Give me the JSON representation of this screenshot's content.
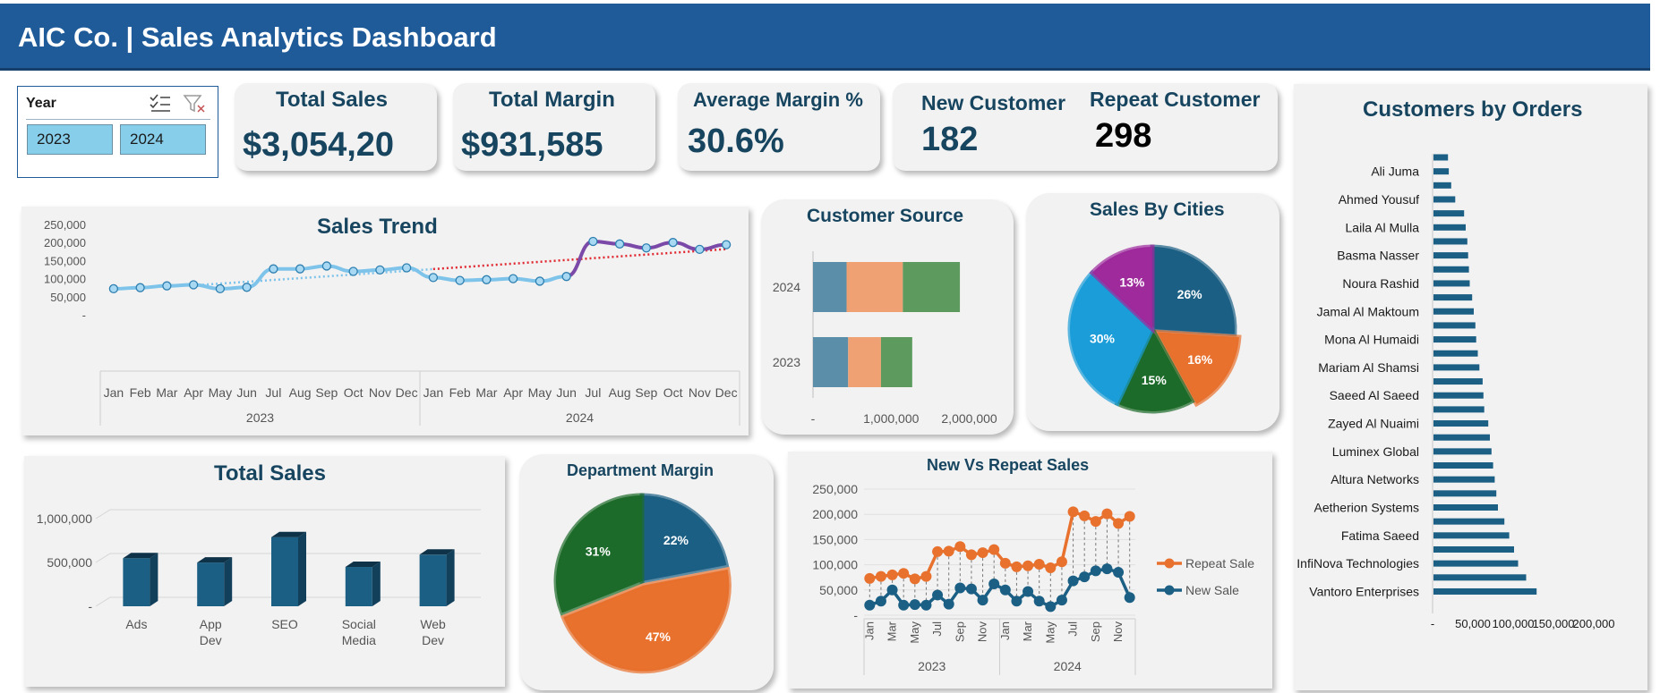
{
  "header": {
    "title": "AIC Co. | Sales Analytics Dashboard"
  },
  "slicer": {
    "title": "Year",
    "options": [
      "2023",
      "2024"
    ]
  },
  "kpis": {
    "total_sales": {
      "label": "Total Sales",
      "value": "$3,054,20"
    },
    "total_margin": {
      "label": "Total Margin",
      "value": "$931,585"
    },
    "average_margin": {
      "label": "Average Margin %",
      "value": "30.6%"
    },
    "new_customer": {
      "label": "New Customer",
      "value": "182"
    },
    "repeat_customer": {
      "label": "Repeat Customer",
      "value": "298"
    }
  },
  "colors": {
    "header": "#1f5b99",
    "text": "#17455f",
    "trend_2023": "#7ec3ea",
    "trend_2024": "#7b4aa8",
    "trendline": "#e0262e",
    "bar": "#1b5f84",
    "orange": "#e8712e",
    "green": "#1d6b2a",
    "light_blue": "#1b9dd9",
    "purple": "#9e2a9c",
    "src_1": "#5b8ea8",
    "src_2": "#f0a173",
    "src_3": "#5c9a5e"
  },
  "chart_data": [
    {
      "id": "sales-trend",
      "type": "line",
      "title": "Sales Trend",
      "categories": [
        "Jan",
        "Feb",
        "Mar",
        "Apr",
        "May",
        "Jun",
        "Jul",
        "Aug",
        "Sep",
        "Oct",
        "Nov",
        "Dec",
        "Jan",
        "Feb",
        "Mar",
        "Apr",
        "May",
        "Jun",
        "Jul",
        "Aug",
        "Sep",
        "Oct",
        "Nov",
        "Dec"
      ],
      "groups": [
        "2023",
        "2024"
      ],
      "values": [
        72000,
        75000,
        80000,
        83000,
        72000,
        76000,
        127000,
        127000,
        135000,
        120000,
        124000,
        130000,
        103000,
        95000,
        97000,
        100000,
        93000,
        106000,
        203000,
        196000,
        185000,
        200000,
        181000,
        194000
      ],
      "yticks": [
        "-",
        "50,000",
        "100,000",
        "150,000",
        "200,000",
        "250,000"
      ],
      "ylim": [
        0,
        250000
      ],
      "trendline": true
    },
    {
      "id": "customer-source",
      "type": "bar",
      "title": "Customer Source",
      "categories": [
        "2024",
        "2023"
      ],
      "series": [
        {
          "values": [
            430000,
            450000
          ]
        },
        {
          "values": [
            720000,
            420000
          ]
        },
        {
          "values": [
            730000,
            400000
          ]
        }
      ],
      "xticks": [
        "-",
        "1,000,000",
        "2,000,000"
      ],
      "xlim": [
        0,
        2200000
      ]
    },
    {
      "id": "sales-by-cities",
      "type": "pie",
      "title": "Sales By Cities",
      "slices": [
        {
          "value": 26,
          "label": "26%"
        },
        {
          "value": 16,
          "label": "16%"
        },
        {
          "value": 15,
          "label": "15%"
        },
        {
          "value": 30,
          "label": "30%"
        },
        {
          "value": 13,
          "label": "13%"
        }
      ]
    },
    {
      "id": "customers-by-orders",
      "type": "bar",
      "title": "Customers by Orders",
      "categories": [
        "",
        "Ali Juma",
        "",
        "Ahmed Yousuf",
        "",
        "Laila Al Mulla",
        "",
        "Basma Nasser",
        "",
        "Noura Rashid",
        "",
        "Jamal Al Maktoum",
        "",
        "Mona Al Humaidi",
        "",
        "Mariam Al Shamsi",
        "",
        "Saeed Al Saeed",
        "",
        "Zayed Al Nuaimi",
        "",
        "Luminex Global",
        "",
        "Altura Networks",
        "",
        "Aetherion Systems",
        "",
        "Fatima Saeed",
        "",
        "InfiNova Technologies",
        "",
        "Vantoro Enterprises"
      ],
      "values": [
        18000,
        19000,
        22000,
        27000,
        38000,
        40000,
        42000,
        43000,
        44000,
        45000,
        48000,
        50000,
        52000,
        53000,
        55000,
        57000,
        61000,
        62000,
        63000,
        68000,
        70000,
        72000,
        74000,
        76000,
        78000,
        80000,
        88000,
        94000,
        100000,
        105000,
        115000,
        128000
      ],
      "xticks": [
        "-",
        "50,000",
        "100,000",
        "150,000",
        "200,000"
      ],
      "xlim": [
        0,
        200000
      ]
    },
    {
      "id": "total-sales-category",
      "type": "bar",
      "title": "Total Sales",
      "categories": [
        "Ads",
        "App Dev",
        "SEO",
        "Social Media",
        "Web Dev"
      ],
      "values": [
        610000,
        560000,
        850000,
        510000,
        650000
      ],
      "yticks": [
        "-",
        "500,000",
        "1,000,000"
      ],
      "ylim": [
        0,
        1200000
      ]
    },
    {
      "id": "department-margin",
      "type": "pie",
      "title": "Department Margin",
      "slices": [
        {
          "value": 22,
          "label": "22%"
        },
        {
          "value": 47,
          "label": "47%"
        },
        {
          "value": 31,
          "label": "31%"
        }
      ]
    },
    {
      "id": "new-vs-repeat",
      "type": "line",
      "title": "New Vs Repeat Sales",
      "categories": [
        "Jan",
        "Mar",
        "May",
        "Jul",
        "Sep",
        "Nov",
        "Jan",
        "Mar",
        "May",
        "Jul",
        "Sep",
        "Nov"
      ],
      "groups": [
        "2023",
        "2024"
      ],
      "series": [
        {
          "name": "Repeat Sale",
          "values": [
            73000,
            77000,
            80000,
            83000,
            72000,
            77000,
            126000,
            127000,
            136000,
            120000,
            124000,
            130000,
            103000,
            96000,
            98000,
            101000,
            94000,
            106000,
            205000,
            197000,
            186000,
            201000,
            182000,
            196000
          ]
        },
        {
          "name": "New Sale",
          "values": [
            20000,
            28000,
            50000,
            20000,
            21000,
            20000,
            40000,
            22000,
            54000,
            52000,
            30000,
            62000,
            50000,
            28000,
            47000,
            28000,
            17000,
            30000,
            68000,
            76000,
            88000,
            92000,
            85000,
            35000
          ]
        }
      ],
      "yticks": [
        "-",
        "50,000",
        "100,000",
        "150,000",
        "200,000",
        "250,000"
      ],
      "ylim": [
        0,
        250000
      ]
    }
  ]
}
